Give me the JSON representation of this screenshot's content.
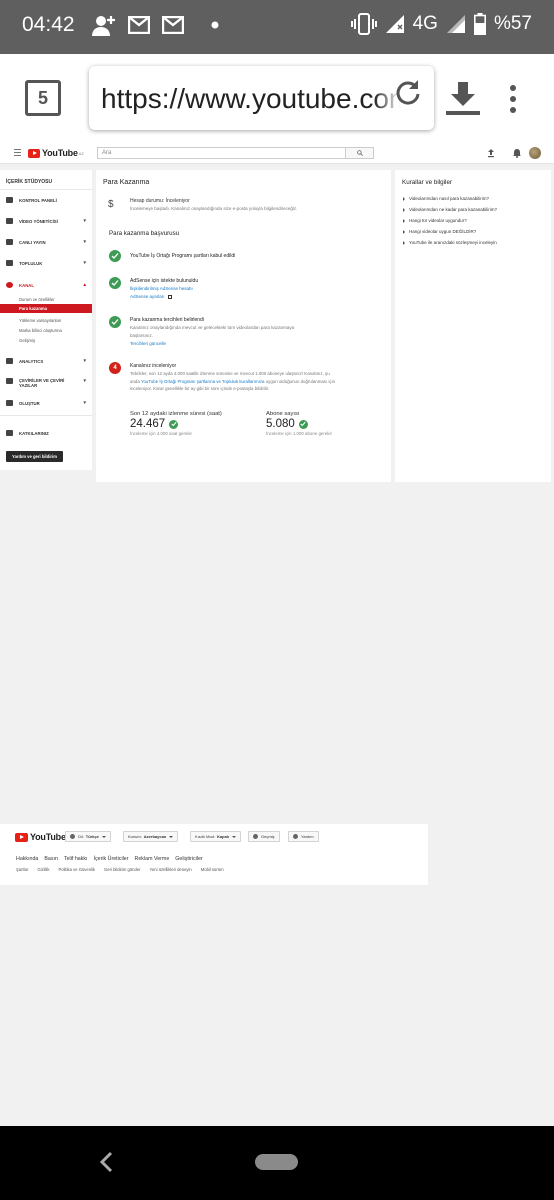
{
  "status_bar": {
    "time": "04:42",
    "network": "4G",
    "battery": "%57",
    "left_icons": [
      "add-person-icon",
      "gmail-icon",
      "gmail-icon",
      "dot-icon"
    ],
    "right_icons": [
      "vibrate-icon",
      "signal-icon",
      "signal-icon",
      "battery-icon"
    ]
  },
  "browser": {
    "tab_count": "5",
    "url": "https://www.youtube.com/"
  },
  "yt_header": {
    "logo": "YouTube",
    "logo_sup": "AZ",
    "search_placeholder": "Ara"
  },
  "left_nav": {
    "title": "İÇERİK STÜDYOSU",
    "items": [
      {
        "label": "KONTROL PANELİ"
      },
      {
        "label": "VİDEO YÖNETİCİSİ"
      },
      {
        "label": "CANLI YAYIN"
      },
      {
        "label": "TOPLULUK"
      },
      {
        "label": "KANAL"
      },
      {
        "label": "ANALYTICS"
      },
      {
        "label": "ÇEVİRİLER VE ÇEVİRİ YAZILAR"
      },
      {
        "label": "OLUŞTUR"
      },
      {
        "label": "KATKILARINIZ"
      }
    ],
    "sub_items": [
      {
        "label": "Durum ve özellikler"
      },
      {
        "label": "Para kazanma"
      },
      {
        "label": "Yükleme varsayılanları"
      },
      {
        "label": "Marka bilinci oluşturma"
      },
      {
        "label": "Gelişmiş"
      }
    ],
    "feedback_button": "Yardım ve geri bildirim"
  },
  "main": {
    "title": "Para Kazanma",
    "account_status": "Hesap durumu: İnceleniyor",
    "account_desc": "İncelemeye başladı. Kanalınız onaylandığında size e-posta yoluyla bilgilendireceğiz.",
    "application_title": "Para kazanma başvurusu",
    "steps": [
      {
        "title": "YouTube İş Ortağı Programı şartları kabul edildi"
      },
      {
        "title": "AdSense için istekte bulunuldu",
        "link1": "İlişkilendirilmiş AdSense hesabı",
        "link2": "AdSense ayarları"
      },
      {
        "title": "Para kazanma tercihleri belirlendi",
        "line1": "Kanalınız onaylandığında mevcut ve gelecekteki tüm videolardan para kazanmaya",
        "line2": "başlarsınız.",
        "link": "Tercihleri güncelle"
      },
      {
        "number": "4",
        "title": "Kanalınız inceleniyor",
        "para_a": "Tebrikler, son 12 ayda 4.000 saatlik izlenme süresine ve mevcut 1.000 aboneye ulaştınız! Kanalınız, şu anda ",
        "para_link": "YouTube İş Ortağı Programı şartlarına ve Topluluk kurallarımıza",
        "para_b": " uygun olduğunun doğrulanması için inceleniyor. Karar genellikle bir ay gibi bir süre içinde e-postayla bildirilir."
      }
    ],
    "metrics": [
      {
        "label": "Son 12 aydaki izlenme süresi (saat)",
        "value": "24.467",
        "note": "İnceleme için 4.000 saat gerekir"
      },
      {
        "label": "Abone sayısı",
        "value": "5.080",
        "note": "İnceleme için 1.000 abone gerekir"
      }
    ]
  },
  "right_panel": {
    "title": "Kurallar ve bilgiler",
    "items": [
      "Videolarımdan nasıl para kazanabilirim?",
      "Videolarımdan ne kadar para kazanabilirim?",
      "Hangi tür videolar uygundur?",
      "Hangi videolar uygun DEĞİLDİR?",
      "YouTube ile aranızdaki sözleşmeyi inceleyin"
    ]
  },
  "footer": {
    "logo": "YouTube",
    "language_label": "Dil:",
    "language_value": "Türkçe",
    "location_label": "Konum:",
    "location_value": "Azerbaycan",
    "restricted_label": "Kısıtlı Mod:",
    "restricted_value": "Kapalı",
    "history_button": "Geçmiş",
    "help_button": "Yardım",
    "links": [
      "Hakkında",
      "Basın",
      "Telif hakkı",
      "İçerik Üreticiler",
      "Reklam Verme",
      "Geliştiriciler"
    ],
    "links_secondary": [
      "Şartlar",
      "Gizlilik",
      "Politika ve Güvenlik",
      "Geri bildirim gönder",
      "Yeni özellikleri deneyin",
      "Mobil sürüm"
    ]
  },
  "colors": {
    "yt_red": "#e62117",
    "active_red": "#cc181e",
    "check_green": "#3d9b55",
    "link_blue": "#167ac6"
  }
}
